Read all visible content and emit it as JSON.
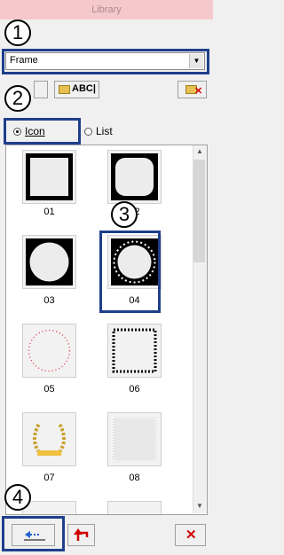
{
  "window": {
    "title": "Library"
  },
  "frame_select": {
    "value": "Frame"
  },
  "toolbar": {
    "abc_label": "ABC|"
  },
  "view_mode": {
    "icon_label": "Icon",
    "list_label": "List",
    "selected": "Icon"
  },
  "gallery": {
    "items": [
      {
        "label": "01",
        "kind": "square-frame"
      },
      {
        "label": "02",
        "kind": "rounded-frame"
      },
      {
        "label": "03",
        "kind": "circle-frame"
      },
      {
        "label": "04",
        "kind": "lace-circle-frame"
      },
      {
        "label": "05",
        "kind": "dotted-circle-frame"
      },
      {
        "label": "06",
        "kind": "checker-square-frame"
      },
      {
        "label": "07",
        "kind": "laurel-wreath"
      },
      {
        "label": "08",
        "kind": "sparkle-frame"
      }
    ]
  },
  "callouts": [
    "1",
    "2",
    "3",
    "4"
  ],
  "colors": {
    "callout_box": "#1f3f8c",
    "delete_red": "#d00000",
    "title_bar": "#f5c8cb"
  }
}
